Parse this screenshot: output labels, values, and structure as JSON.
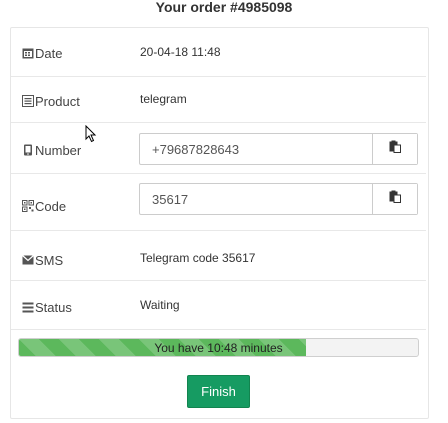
{
  "order": {
    "title": "Your order #4985098"
  },
  "rows": {
    "date": {
      "label": "Date",
      "value": "20-04-18 11:48",
      "icon": "calendar-icon"
    },
    "product": {
      "label": "Product",
      "value": "telegram",
      "icon": "list-icon"
    },
    "number": {
      "label": "Number",
      "value": "+79687828643",
      "icon": "mobile-icon"
    },
    "code": {
      "label": "Code",
      "value": "35617",
      "icon": "qrcode-icon"
    },
    "sms": {
      "label": "SMS",
      "value": "Telegram code 35617",
      "icon": "envelope-icon"
    },
    "status": {
      "label": "Status",
      "value": "Waiting",
      "icon": "menu-icon"
    }
  },
  "progress": {
    "text": "You have 10:48 minutes",
    "fraction": 0.72,
    "color": "#5cb85c"
  },
  "finish": {
    "label": "Finish",
    "color": "#169b62"
  }
}
